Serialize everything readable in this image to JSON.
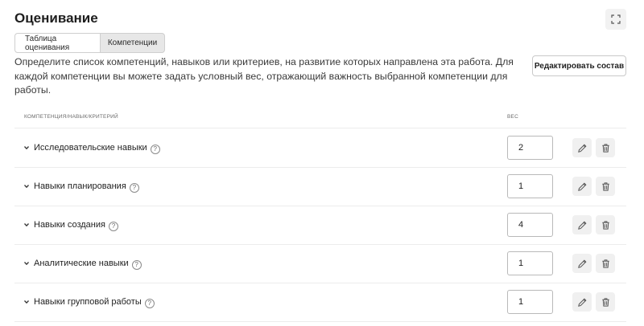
{
  "header": {
    "title": "Оценивание"
  },
  "tabs": [
    {
      "label": "Таблица оценивания",
      "active": false
    },
    {
      "label": "Компетенции",
      "active": true
    }
  ],
  "description": "Определите список компетенций, навыков или критериев, на развитие которых направлена эта работа. Для каждой компетенции вы можете задать условный вес, отражающий важность выбранной компетенции для работы.",
  "actions": {
    "edit_composition_label": "Редактировать состав"
  },
  "table": {
    "columns": {
      "name": "КОМПЕТЕНЦИЯ/НАВЫК/КРИТЕРИЙ",
      "weight": "ВЕС"
    },
    "rows": [
      {
        "name": "Исследовательские навыки",
        "weight": "2"
      },
      {
        "name": "Навыки планирования",
        "weight": "1"
      },
      {
        "name": "Навыки создания",
        "weight": "4"
      },
      {
        "name": "Аналитические навыки",
        "weight": "1"
      },
      {
        "name": "Навыки групповой работы",
        "weight": "1"
      }
    ],
    "help_glyph": "?"
  },
  "icons": {
    "expand": "expand-icon",
    "chevron": "chevron-down-icon",
    "help": "help-icon",
    "edit": "pencil-icon",
    "delete": "trash-icon"
  }
}
